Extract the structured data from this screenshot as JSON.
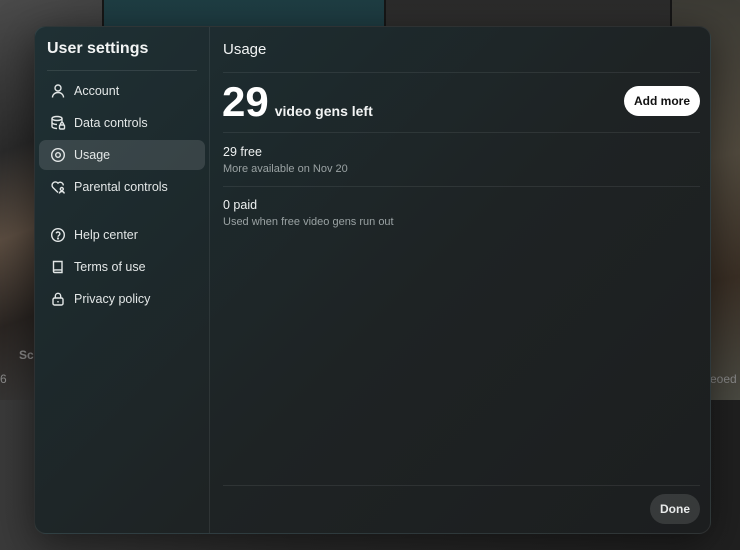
{
  "background": {
    "left_text_1": "Sc",
    "left_text_2": "6",
    "right_text": "eoed"
  },
  "sidebar": {
    "title": "User settings",
    "items": [
      {
        "label": "Account",
        "icon": "person-icon"
      },
      {
        "label": "Data controls",
        "icon": "database-icon"
      },
      {
        "label": "Usage",
        "icon": "usage-icon",
        "active": true
      },
      {
        "label": "Parental controls",
        "icon": "heart-person-icon"
      },
      {
        "label": "Help center",
        "icon": "help-icon"
      },
      {
        "label": "Terms of use",
        "icon": "book-icon"
      },
      {
        "label": "Privacy policy",
        "icon": "lock-icon"
      }
    ]
  },
  "main": {
    "title": "Usage",
    "count": "29",
    "count_label": "video gens left",
    "add_more_label": "Add more",
    "free": {
      "title": "29 free",
      "subtitle": "More available on Nov 20"
    },
    "paid": {
      "title": "0 paid",
      "subtitle": "Used when free video gens run out"
    },
    "done_label": "Done"
  },
  "colors": {
    "modal_bg": "#1e2324",
    "accent_button": "#ffffff",
    "active_item_bg": "#3a3f40"
  }
}
